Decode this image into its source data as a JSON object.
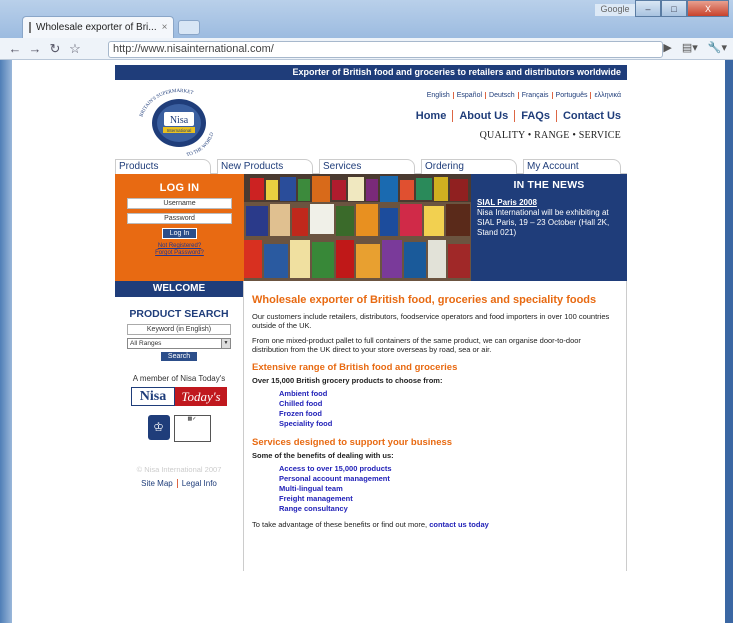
{
  "browser": {
    "tab_title": "Wholesale exporter of Bri...",
    "tab_close": "×",
    "url": "http://www.nisainternational.com/",
    "google_label": "Google",
    "window_buttons": [
      "–",
      "□",
      "X"
    ]
  },
  "site": {
    "banner_text": "Exporter of British food and groceries to retailers and distributors worldwide",
    "logo": {
      "name": "Nisa",
      "arc_top": "BRITAIN'S SUPERMARKET",
      "arc_bottom": "TO THE WORLD",
      "badge": "International"
    },
    "languages": [
      "English",
      "Español",
      "Deutsch",
      "Français",
      "Português",
      "ελληνικά"
    ],
    "main_nav": [
      "Home",
      "About Us",
      "FAQs",
      "Contact Us"
    ],
    "tagline": "QUALITY • RANGE • SERVICE",
    "tabs": [
      "Products",
      "New Products",
      "Services",
      "Ordering",
      "My Account"
    ],
    "login": {
      "title": "LOG IN",
      "username_placeholder": "Username",
      "password_placeholder": "Password",
      "button": "Log In",
      "not_registered": "Not Registered?",
      "forgot_password": "Forgot Password?"
    },
    "news": {
      "title": "IN THE NEWS",
      "headline": "SIAL Paris 2008",
      "body": "Nisa International will be exhibiting at SIAL Paris, 19 – 23 October (Hall 2K, Stand 021)"
    },
    "sidebar": {
      "welcome": "WELCOME",
      "product_search_title": "PRODUCT SEARCH",
      "keyword_placeholder": "Keyword (in English)",
      "range_selected": "All Ranges",
      "search_button": "Search",
      "member_text": "A member of Nisa Today's",
      "member_logo_left": "Nisa",
      "member_logo_right": "Today's",
      "copyright": "© Nisa International 2007",
      "footer_links": [
        "Site Map",
        "Legal Info"
      ]
    },
    "content": {
      "heading": "Wholesale exporter of British food, groceries and speciality foods",
      "para1": "Our customers include retailers, distributors, foodservice operators and food importers in over 100 countries outside of the UK.",
      "para2": "From one mixed-product pallet to full containers of the same product, we can organise door-to-door distribution from the UK direct to your store overseas by road, sea or air.",
      "range_heading": "Extensive range of British food and groceries",
      "range_intro": "Over 15,000 British grocery products to choose from:",
      "range_items": [
        "Ambient food",
        "Chilled food",
        "Frozen food",
        "Speciality food"
      ],
      "services_heading": "Services designed to support your business",
      "services_intro": "Some of the benefits of dealing with us:",
      "services_items": [
        "Access to over 15,000 products",
        "Personal account management",
        "Multi-lingual team",
        "Freight management",
        "Range consultancy"
      ],
      "closing_text": "To take advantage of these benefits or find out more,",
      "closing_link": "contact us today"
    }
  }
}
